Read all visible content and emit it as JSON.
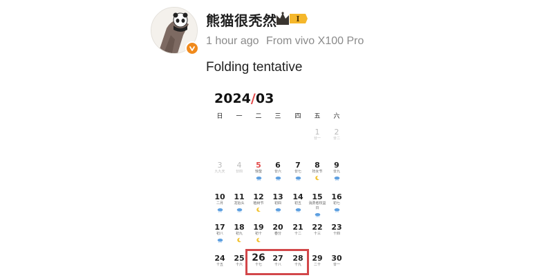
{
  "post": {
    "username": "熊猫很秃然",
    "level_badge": "I",
    "time_ago": "1 hour ago",
    "source": "From vivo X100 Pro",
    "text": "Folding tentative"
  },
  "calendar": {
    "year": "2024",
    "separator": "/",
    "month": "03",
    "weekdays": [
      "日",
      "一",
      "二",
      "三",
      "四",
      "五",
      "六"
    ],
    "days": [
      {
        "num": "1",
        "sub": "廿一",
        "faded": true
      },
      {
        "num": "2",
        "sub": "廿二",
        "faded": true
      },
      {
        "num": "3",
        "sub": "九九天",
        "faded": true
      },
      {
        "num": "4",
        "sub": "廿四",
        "faded": true
      },
      {
        "num": "5",
        "sub": "惊蛰",
        "red": true,
        "wx": "cloud"
      },
      {
        "num": "6",
        "sub": "廿六",
        "wx": "cloud"
      },
      {
        "num": "7",
        "sub": "廿七",
        "wx": "cloud"
      },
      {
        "num": "8",
        "sub": "妇女节",
        "wx": "moon"
      },
      {
        "num": "9",
        "sub": "廿九",
        "wx": "cloud"
      },
      {
        "num": "10",
        "sub": "二月",
        "wx": "cloud"
      },
      {
        "num": "11",
        "sub": "龙抬头",
        "wx": "cloud"
      },
      {
        "num": "12",
        "sub": "植树节",
        "wx": "moon"
      },
      {
        "num": "13",
        "sub": "初四",
        "wx": "cloud"
      },
      {
        "num": "14",
        "sub": "初五",
        "wx": "cloud"
      },
      {
        "num": "15",
        "sub": "消费者权益日",
        "wx": "cloud"
      },
      {
        "num": "16",
        "sub": "初七",
        "wx": "cloud"
      },
      {
        "num": "17",
        "sub": "初八",
        "wx": "cloud"
      },
      {
        "num": "18",
        "sub": "初九",
        "wx": "moon"
      },
      {
        "num": "19",
        "sub": "初十",
        "wx": "moon"
      },
      {
        "num": "20",
        "sub": "春分"
      },
      {
        "num": "21",
        "sub": "十二"
      },
      {
        "num": "22",
        "sub": "十三"
      },
      {
        "num": "23",
        "sub": "十四"
      },
      {
        "num": "24",
        "sub": "十五"
      },
      {
        "num": "25",
        "sub": "十六"
      },
      {
        "num": "26",
        "sub": "十七",
        "big": true
      },
      {
        "num": "27",
        "sub": "十八"
      },
      {
        "num": "28",
        "sub": "十九"
      },
      {
        "num": "29",
        "sub": "二十"
      },
      {
        "num": "30",
        "sub": "廿一"
      }
    ]
  },
  "colors": {
    "accent_red": "#e24a4a",
    "highlight_box": "#d2474a",
    "badge_orange": "#f08a1c"
  },
  "icons": {
    "avatar": "panda-avatar-icon",
    "verified": "verified-badge-icon",
    "crown": "crown-icon"
  }
}
